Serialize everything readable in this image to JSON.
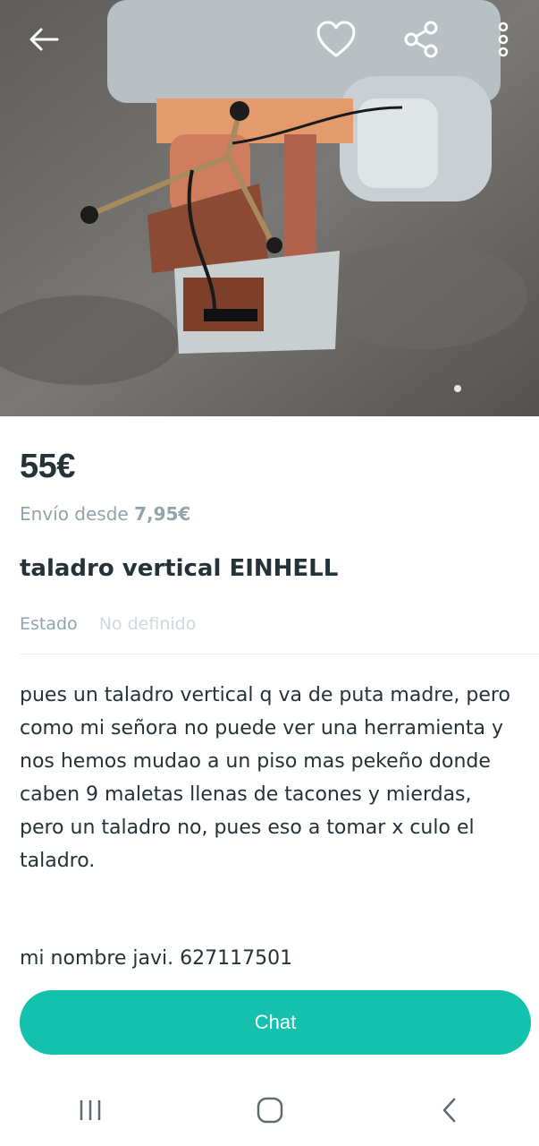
{
  "listing": {
    "price": "55€",
    "shipping_prefix": "Envío desde",
    "shipping_price": "7,95€",
    "title": "taladro vertical EINHELL",
    "condition_label": "Estado",
    "condition_value": "No definido",
    "description": "pues un taladro vertical q va de puta madre, pero como mi señora no puede ver una herramienta y nos hemos mudao a un piso mas pekeño donde caben 9 maletas llenas de tacones y mierdas, pero un taladro no, pues eso a tomar x culo el taladro.",
    "contact": "mi nombre javi. 627117501"
  },
  "actions": {
    "chat_label": "Chat"
  },
  "icons": {
    "back": "arrow-left-icon",
    "favorite": "heart-icon",
    "share": "share-icon",
    "more": "more-vertical-icon",
    "nav_recent": "recent-apps-icon",
    "nav_home": "home-icon",
    "nav_back": "back-icon"
  },
  "colors": {
    "accent": "#13c1ac",
    "text_primary": "#253238",
    "text_muted": "#90a4ae",
    "text_faint": "#cfd8dc"
  }
}
